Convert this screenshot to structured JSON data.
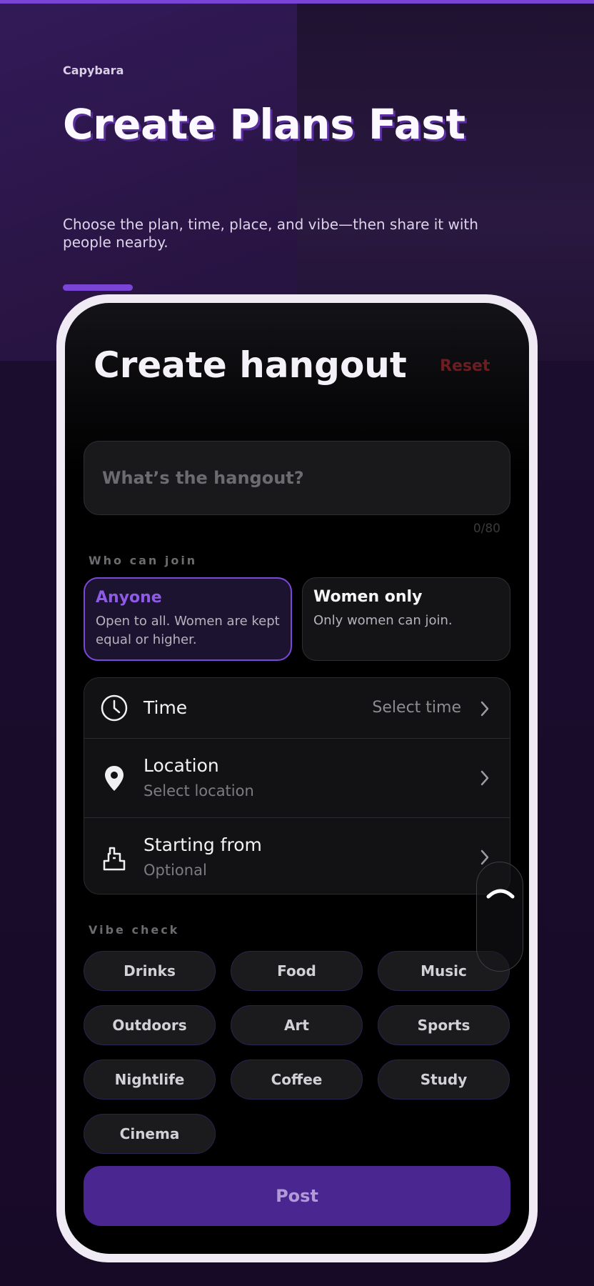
{
  "brand": "Capybara",
  "hero": {
    "title": "Create Plans Fast",
    "subtitle": "Choose the plan, time, place, and vibe—then share it with people nearby."
  },
  "screen": {
    "title": "Create hangout",
    "reset_label": "Reset",
    "input_placeholder": "What’s the hangout?",
    "char_counter": "0/80",
    "who_label": "Who can join",
    "join_options": [
      {
        "title": "Anyone",
        "desc": "Open to all. Women are kept equal or higher.",
        "selected": true
      },
      {
        "title": "Women only",
        "desc": "Only women can join.",
        "selected": false
      }
    ],
    "rows": {
      "time": {
        "label": "Time",
        "value": "Select time",
        "icon": "clock-icon"
      },
      "location": {
        "label": "Location",
        "sub": "Select location",
        "icon": "map-pin-icon"
      },
      "start": {
        "label": "Starting from",
        "sub": "Optional",
        "icon": "building-icon"
      }
    },
    "vibe_label": "Vibe check",
    "vibes": [
      "Drinks",
      "Food",
      "Music",
      "Outdoors",
      "Art",
      "Sports",
      "Nightlife",
      "Coffee",
      "Study",
      "Cinema"
    ],
    "post_label": "Post"
  },
  "colors": {
    "accent": "#7b48d9",
    "post_button": "#4a2690",
    "reset": "#6b1e22",
    "background": "#1a0c2b"
  }
}
